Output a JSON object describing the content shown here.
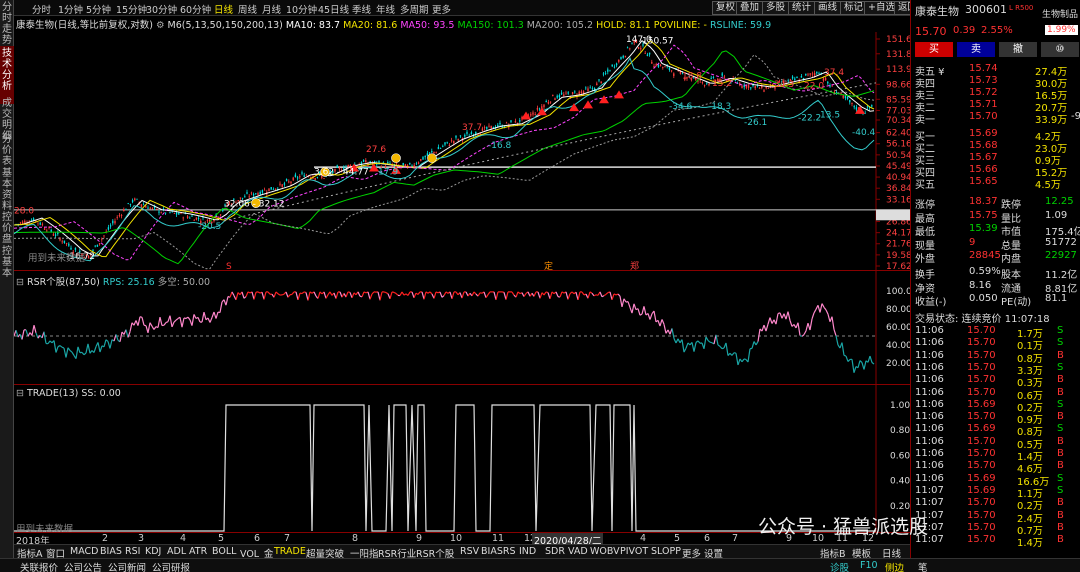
{
  "left_tabs": [
    "分时走势",
    "技术分析",
    "成交明细",
    "分价表",
    "基本资料",
    "控价盘",
    "控基本"
  ],
  "periods": [
    "分时",
    "1分钟",
    "5分钟",
    "15分钟",
    "30分钟",
    "60分钟",
    "日线",
    "周线",
    "月线",
    "10分钟",
    "45日线",
    "季线",
    "年线",
    "多周期",
    "更多"
  ],
  "active_period": "日线",
  "toolbar_buttons": [
    "复权",
    "叠加",
    "多股",
    "统计",
    "画线",
    "标记",
    "+自选",
    "返回"
  ],
  "main_legend": {
    "title": "康泰生物(日线,等比前复权,对数)",
    "ma_label": "M6(5,13,50,150,200,13)",
    "ma10": "MA10: 83.7",
    "ma20": "MA20: 81.6",
    "ma50": "MA50: 93.5",
    "ma150": "MA150: 101.3",
    "ma200": "MA200: 105.2",
    "hold": "HOLD: 81.1",
    "poviline": "POVILINE: -",
    "rsline": "RSLINE: 59.9"
  },
  "y_axis_labels": [
    "151.6",
    "131.8",
    "113.9",
    "98.66",
    "85.59",
    "77.03",
    "70.34",
    "62.40",
    "56.16",
    "50.54",
    "45.49",
    "40.94",
    "36.84",
    "33.16",
    "28.50",
    "26.86",
    "24.17",
    "21.76",
    "19.58",
    "17.62"
  ],
  "price_annotations": [
    "147.0",
    "150.57",
    "18.8",
    "15.2",
    "34.3",
    "22.0",
    "37.4",
    "-34.6",
    "-18.3",
    "-26.1",
    "-22.2",
    "13.5",
    "-40.4",
    "37.7",
    "-16.8",
    "27.6",
    "3.62 - 44.77",
    "17.9",
    "32.06 - 32.12",
    "-20.5",
    "28.0",
    "-16.72"
  ],
  "main_chart_note": "用到未来数据",
  "markers": [
    "S",
    "定",
    "郑"
  ],
  "rsr_legend": {
    "name": "RSR个股(87,50)",
    "rps": "RPS: 25.16",
    "duokong": "多空: 50.00"
  },
  "rsr_y_labels": [
    "100.0",
    "80.00",
    "60.00",
    "40.00",
    "20.00"
  ],
  "trade_legend": {
    "name": "TRADE(13)",
    "ss": "SS: 0.00"
  },
  "trade_y_labels": [
    "1.00",
    "0.80",
    "0.60",
    "0.40",
    "0.20"
  ],
  "trade_note": "用到未来数据",
  "x_axis_labels": [
    "2018年",
    "2",
    "3",
    "4",
    "5",
    "6",
    "7",
    "8",
    "9",
    "10",
    "11",
    "12",
    "2",
    "3",
    "4",
    "5",
    "6",
    "7",
    "9",
    "10",
    "11",
    "12",
    "2",
    "3",
    "4"
  ],
  "x_axis_date": "2020/04/28/二",
  "indicator_tabs": [
    "指标A",
    "窗口",
    "MACD",
    "BIAS",
    "RSI",
    "KDJ",
    "ADL",
    "ATR",
    "BOLL",
    "VOL_金",
    "TRADE",
    "超量突破",
    "一阳指",
    "RSR行业",
    "RSR个股",
    "RSV",
    "BIASRS",
    "IND",
    "SDR",
    "VAD",
    "WOBV",
    "PIVOT",
    "SLOPP",
    "更多",
    "设置"
  ],
  "active_indicator": "TRADE",
  "indicator_right_tabs": [
    "指标B",
    "模板",
    "日线"
  ],
  "bottom_tabs": [
    "关联报价",
    "公司公告",
    "公司新闻",
    "公司研报"
  ],
  "bottom_right": [
    "诊股",
    "F10",
    "侧边",
    "笔"
  ],
  "watermark": "公众号 · 猛兽派选股",
  "quote": {
    "name": "康泰生物",
    "code": "300601",
    "tag": "L R500",
    "sector": "生物制品",
    "sector_pct": "1.99%",
    "price": "15.70",
    "change": "0.39",
    "pct": "2.55%",
    "actions": [
      "买",
      "卖",
      "撤",
      "⑩"
    ],
    "asks": [
      {
        "label": "卖五 ¥",
        "price": "15.74",
        "vol": "27.4万"
      },
      {
        "label": "卖四",
        "price": "15.73",
        "vol": "30.0万"
      },
      {
        "label": "卖三",
        "price": "15.72",
        "vol": "16.5万"
      },
      {
        "label": "卖二",
        "price": "15.71",
        "vol": "20.7万"
      },
      {
        "label": "卖一",
        "price": "15.70",
        "vol": "33.9万",
        "extra": "-9"
      }
    ],
    "bids": [
      {
        "label": "买一",
        "price": "15.69",
        "vol": "4.2万"
      },
      {
        "label": "买二",
        "price": "15.68",
        "vol": "23.0万"
      },
      {
        "label": "买三",
        "price": "15.67",
        "vol": "0.9万"
      },
      {
        "label": "买四",
        "price": "15.66",
        "vol": "15.2万"
      },
      {
        "label": "买五",
        "price": "15.65",
        "vol": "4.5万"
      }
    ],
    "stats": [
      [
        "涨停",
        "18.37",
        "跌停",
        "12.25"
      ],
      [
        "最高",
        "15.75",
        "量比",
        "1.09"
      ],
      [
        "最低",
        "15.39",
        "市值",
        "175.4亿"
      ],
      [
        "现量",
        "9",
        "总量",
        "51772"
      ],
      [
        "外盘",
        "28845",
        "内盘",
        "22927"
      ]
    ],
    "stats2": [
      [
        "换手",
        "0.59%",
        "股本",
        "11.2亿"
      ],
      [
        "净资",
        "8.16",
        "流通",
        "8.81亿"
      ],
      [
        "收益(-)",
        "0.050",
        "PE(动)",
        "81.1"
      ]
    ],
    "trade_status": "交易状态: 连续竞价 11:07:18",
    "ticks": [
      [
        "11:06",
        "15.70",
        "1.7万",
        "S"
      ],
      [
        "11:06",
        "15.70",
        "0.1万",
        "S"
      ],
      [
        "11:06",
        "15.70",
        "0.8万",
        "B"
      ],
      [
        "11:06",
        "15.70",
        "3.3万",
        "S"
      ],
      [
        "11:06",
        "15.70",
        "0.3万",
        "B"
      ],
      [
        "11:06",
        "15.70",
        "0.6万",
        "B"
      ],
      [
        "11:06",
        "15.69",
        "0.2万",
        "S"
      ],
      [
        "11:06",
        "15.70",
        "0.9万",
        "B"
      ],
      [
        "11:06",
        "15.69",
        "0.8万",
        "S"
      ],
      [
        "11:06",
        "15.70",
        "0.5万",
        "B"
      ],
      [
        "11:06",
        "15.70",
        "1.4万",
        "B"
      ],
      [
        "11:06",
        "15.70",
        "4.6万",
        "B"
      ],
      [
        "11:06",
        "15.69",
        "16.6万",
        "S"
      ],
      [
        "11:07",
        "15.69",
        "1.1万",
        "S"
      ],
      [
        "11:07",
        "15.70",
        "0.2万",
        "B"
      ],
      [
        "11:07",
        "15.70",
        "2.4万",
        "B"
      ],
      [
        "11:07",
        "15.70",
        "0.7万",
        "B"
      ],
      [
        "11:07",
        "15.70",
        "1.4万",
        "B"
      ]
    ]
  }
}
